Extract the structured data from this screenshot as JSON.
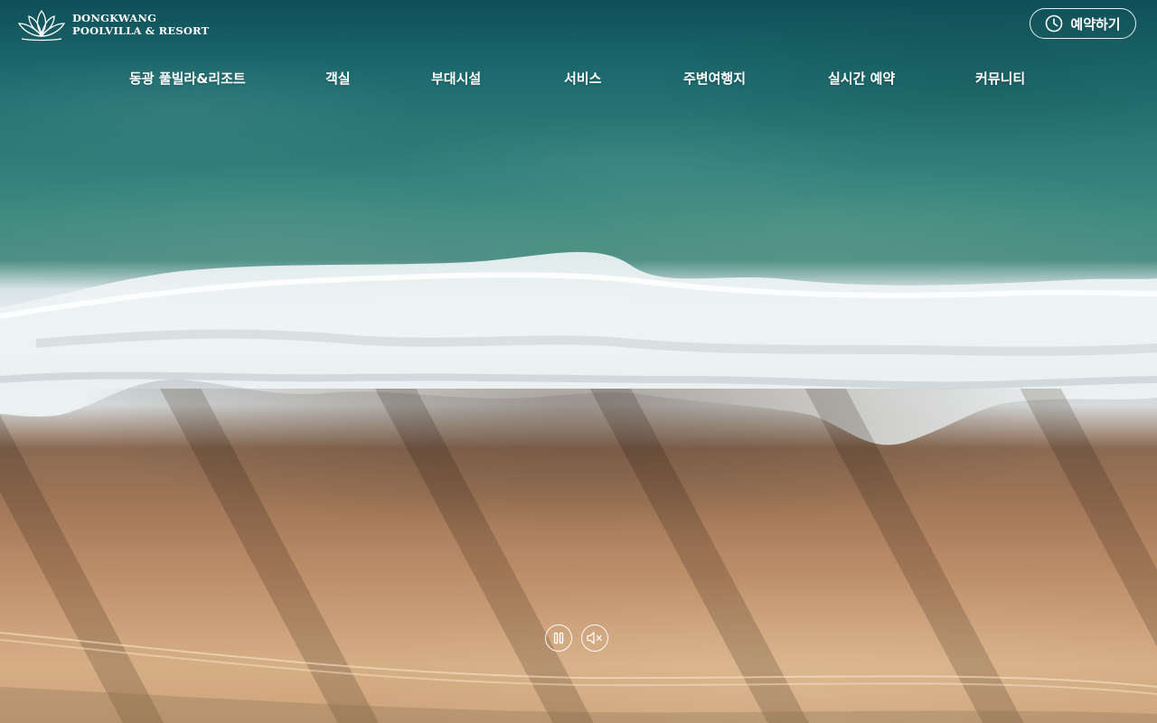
{
  "brand": {
    "line1": "DONGKWANG",
    "line2": "POOLVILLA & RESORT"
  },
  "header": {
    "reserve_label": "예약하기"
  },
  "nav": {
    "items": [
      {
        "label": "동광 풀빌라&리조트"
      },
      {
        "label": "객실"
      },
      {
        "label": "부대시설"
      },
      {
        "label": "서비스"
      },
      {
        "label": "주변여행지"
      },
      {
        "label": "실시간 예약"
      },
      {
        "label": "커뮤니티"
      }
    ]
  },
  "video": {
    "controls": [
      "pause-icon",
      "mute-icon"
    ]
  },
  "colors": {
    "text": "#ffffff"
  }
}
